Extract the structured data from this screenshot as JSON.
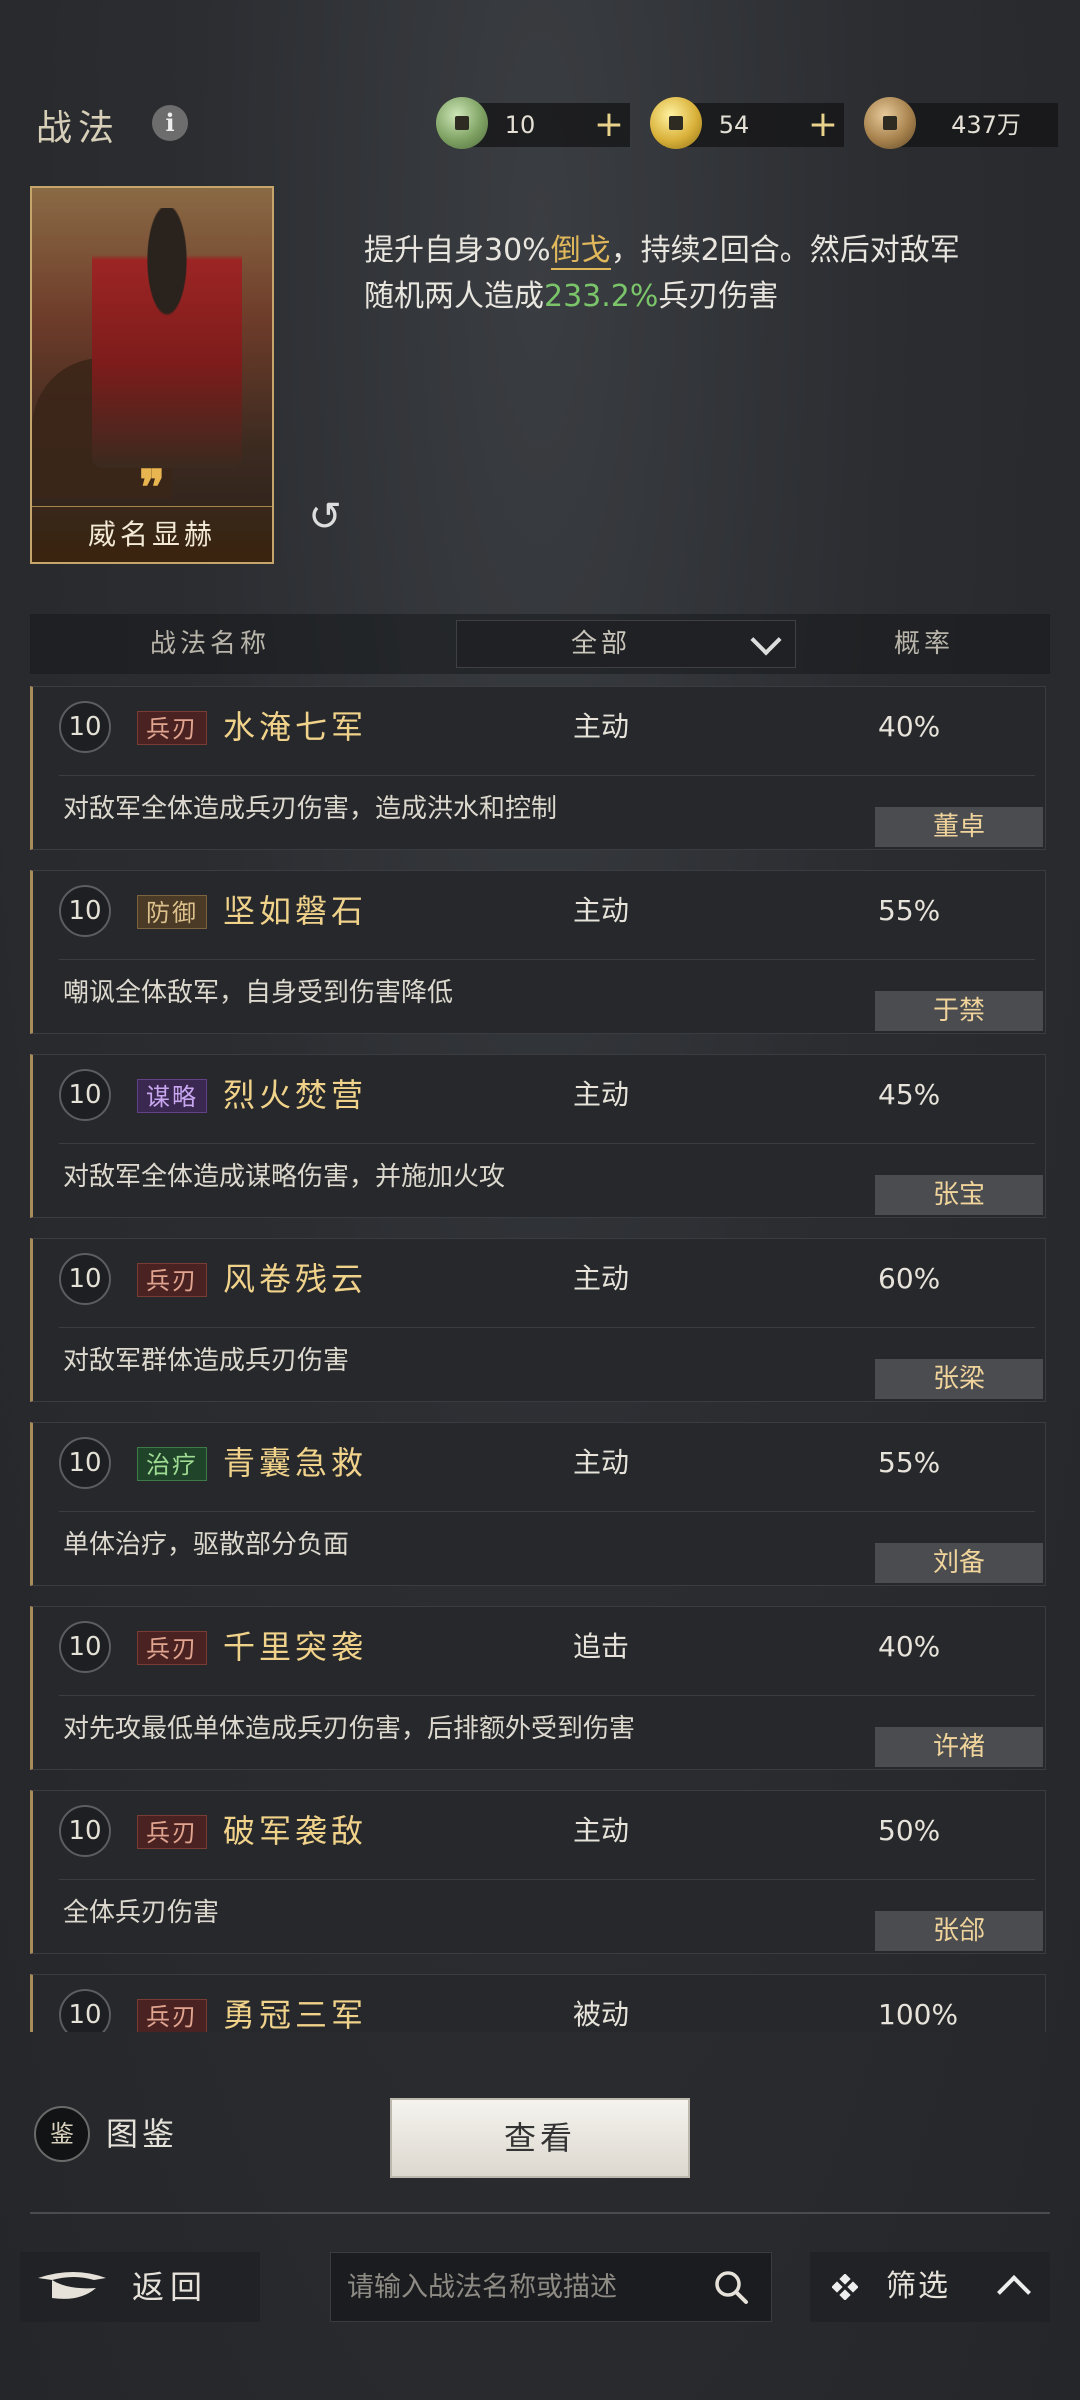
{
  "header": {
    "title": "战法",
    "info_icon": "info-icon",
    "resources": [
      {
        "icon": "jade-coin-icon",
        "value": "10",
        "plus": "+"
      },
      {
        "icon": "gold-coin-icon",
        "value": "54",
        "plus": "+"
      },
      {
        "icon": "copper-coin-icon",
        "value": "437万"
      }
    ]
  },
  "selected": {
    "card_name": "威名显赫",
    "card_mark": "❞",
    "description": {
      "part1": "提升自身30%",
      "highlight": "倒戈",
      "part2": "，持续2回合。然后对敌军随机两人造成",
      "percent": "233.2%",
      "part3": "兵刃伤害"
    }
  },
  "list_header": {
    "name_col": "战法名称",
    "filter_value": "全部",
    "rate_col": "概率"
  },
  "skills": [
    {
      "level": "10",
      "tag": "兵刃",
      "tag_type": "bing",
      "name": "水淹七军",
      "type": "主动",
      "rate": "40%",
      "desc": "对敌军全体造成兵刃伤害，造成洪水和控制",
      "owner": "董卓"
    },
    {
      "level": "10",
      "tag": "防御",
      "tag_type": "fang",
      "name": "坚如磐石",
      "type": "主动",
      "rate": "55%",
      "desc": "嘲讽全体敌军，自身受到伤害降低",
      "owner": "于禁"
    },
    {
      "level": "10",
      "tag": "谋略",
      "tag_type": "mou",
      "name": "烈火焚营",
      "type": "主动",
      "rate": "45%",
      "desc": "对敌军全体造成谋略伤害，并施加火攻",
      "owner": "张宝"
    },
    {
      "level": "10",
      "tag": "兵刃",
      "tag_type": "bing",
      "name": "风卷残云",
      "type": "主动",
      "rate": "60%",
      "desc": "对敌军群体造成兵刃伤害",
      "owner": "张梁"
    },
    {
      "level": "10",
      "tag": "治疗",
      "tag_type": "zhi",
      "name": "青囊急救",
      "type": "主动",
      "rate": "55%",
      "desc": "单体治疗，驱散部分负面",
      "owner": "刘备"
    },
    {
      "level": "10",
      "tag": "兵刃",
      "tag_type": "bing",
      "name": "千里突袭",
      "type": "追击",
      "rate": "40%",
      "desc": "对先攻最低单体造成兵刃伤害，后排额外受到伤害",
      "owner": "许褚"
    },
    {
      "level": "10",
      "tag": "兵刃",
      "tag_type": "bing",
      "name": "破军袭敌",
      "type": "主动",
      "rate": "50%",
      "desc": "全体兵刃伤害",
      "owner": "张郃"
    },
    {
      "level": "10",
      "tag": "兵刃",
      "tag_type": "bing",
      "name": "勇冠三军",
      "type": "被动",
      "rate": "100%",
      "desc": "",
      "owner": ""
    }
  ],
  "bottom": {
    "tujian_icon_text": "鉴",
    "tujian_label": "图鉴",
    "view_button": "查看",
    "back_label": "返回",
    "search_placeholder": "请输入战法名称或描述",
    "filter_label": "筛选"
  },
  "colors": {
    "accent_gold": "#e0b85b",
    "damage_green": "#7ac46a",
    "name_gold": "#f0d28a"
  }
}
